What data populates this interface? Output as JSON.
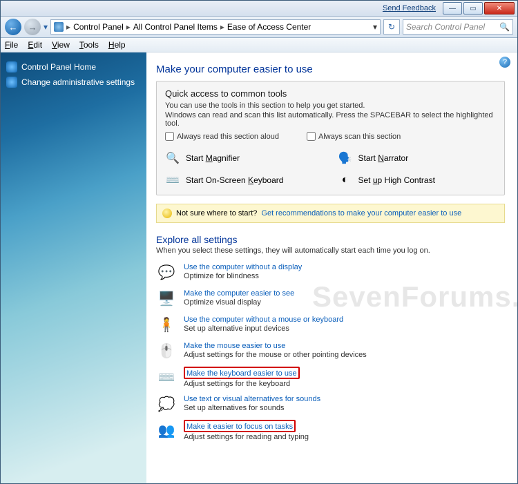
{
  "titlebar": {
    "feedback": "Send Feedback"
  },
  "address": {
    "seg1": "Control Panel",
    "seg2": "All Control Panel Items",
    "seg3": "Ease of Access Center"
  },
  "search": {
    "placeholder": "Search Control Panel"
  },
  "menu": {
    "file": "File",
    "edit": "Edit",
    "view": "View",
    "tools": "Tools",
    "help": "Help"
  },
  "sidebar": {
    "home": "Control Panel Home",
    "admin": "Change administrative settings"
  },
  "main": {
    "title": "Make your computer easier to use",
    "quick_title": "Quick access to common tools",
    "quick_desc1": "You can use the tools in this section to help you get started.",
    "quick_desc2": "Windows can read and scan this list automatically.  Press the SPACEBAR to select the highlighted tool.",
    "chk_aloud": "Always read this section aloud",
    "chk_scan": "Always scan this section",
    "ql_magnifier": "Start Magnifier",
    "ql_narrator": "Start Narrator",
    "ql_osk": "Start On-Screen Keyboard",
    "ql_hc": "Set up High Contrast",
    "tip_q": "Not sure where to start?",
    "tip_link": "Get recommendations to make your computer easier to use",
    "explore_title": "Explore all settings",
    "explore_sub": "When you select these settings, they will automatically start each time you log on.",
    "s1_link": "Use the computer without a display",
    "s1_desc": "Optimize for blindness",
    "s2_link": "Make the computer easier to see",
    "s2_desc": "Optimize visual display",
    "s3_link": "Use the computer without a mouse or keyboard",
    "s3_desc": "Set up alternative input devices",
    "s4_link": "Make the mouse easier to use",
    "s4_desc": "Adjust settings for the mouse or other pointing devices",
    "s5_link": "Make the keyboard easier to use",
    "s5_desc": "Adjust settings for the keyboard",
    "s6_link": "Use text or visual alternatives for sounds",
    "s6_desc": "Set up alternatives for sounds",
    "s7_link": "Make it easier to focus on tasks",
    "s7_desc": "Adjust settings for reading and typing"
  },
  "watermark": "SevenForums.com"
}
